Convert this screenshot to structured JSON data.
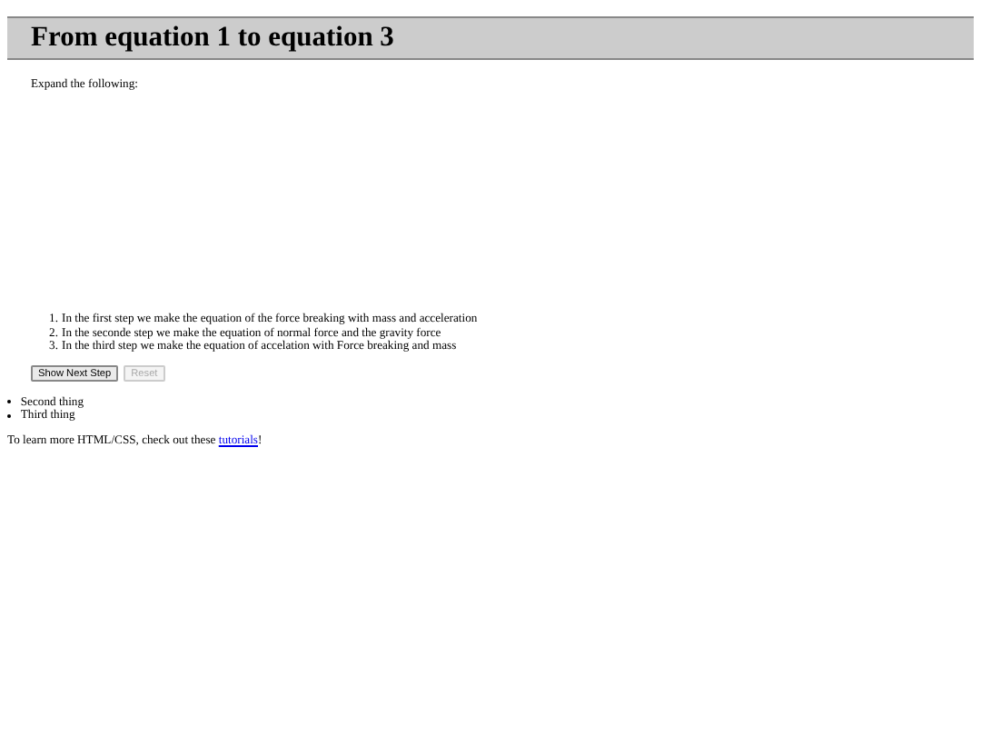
{
  "heading": "From equation 1 to equation 3",
  "intro": "Expand the following:",
  "steps": [
    {
      "number": "1.",
      "text": "In the first step we make the equation of the force breaking with mass and acceleration"
    },
    {
      "number": "2.",
      "text": "In the seconde step we make the equation of normal force and the gravity force"
    },
    {
      "number": "3.",
      "text": "In the third step we make the equation of accelation with Force breaking and mass"
    }
  ],
  "buttons": [
    {
      "label": "Show Next Step",
      "disabled": false
    },
    {
      "label": "Reset",
      "disabled": true
    }
  ],
  "bullets": [
    "Second thing",
    "Third thing"
  ],
  "footer": {
    "text": "To learn more HTML/CSS, check out these ",
    "link": "tutorials",
    "end": "!"
  }
}
